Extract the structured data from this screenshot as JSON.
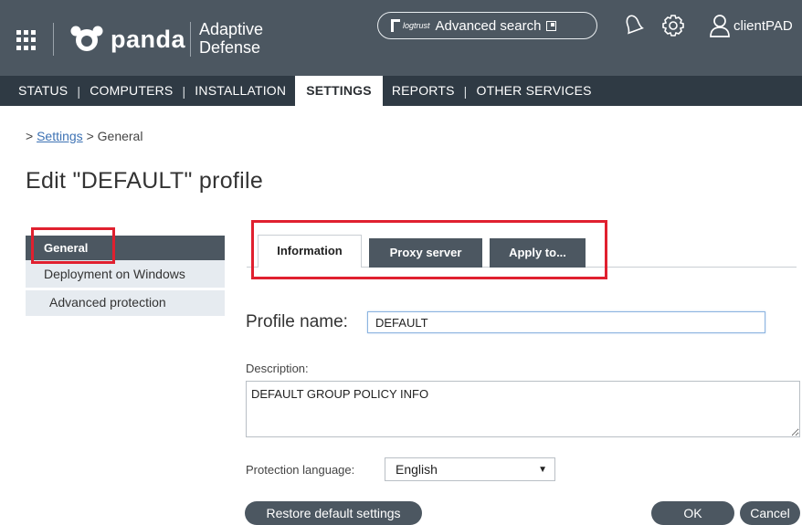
{
  "header": {
    "brand": "panda",
    "product_line1": "Adaptive",
    "product_line2": "Defense",
    "search_brand": "logtrust",
    "search_label": "Advanced search",
    "user_name": "clientPAD"
  },
  "nav": {
    "items": [
      "STATUS",
      "COMPUTERS",
      "INSTALLATION",
      "SETTINGS",
      "REPORTS",
      "OTHER SERVICES"
    ],
    "active": "SETTINGS"
  },
  "breadcrumb": {
    "prefix": ">",
    "link": "Settings",
    "separator": ">",
    "current": "General"
  },
  "page_title": "Edit \"DEFAULT\" profile",
  "sidebar": {
    "items": [
      {
        "label": "General"
      },
      {
        "label": "Deployment on Windows"
      },
      {
        "label": "Advanced protection"
      }
    ]
  },
  "tabs": [
    "Information",
    "Proxy server",
    "Apply to..."
  ],
  "form": {
    "profile_name_label": "Profile name:",
    "profile_name_value": "DEFAULT",
    "description_label": "Description:",
    "description_value": "DEFAULT GROUP POLICY INFO",
    "language_label": "Protection language:",
    "language_value": "English"
  },
  "buttons": {
    "restore": "Restore default settings",
    "ok": "OK",
    "cancel": "Cancel"
  },
  "colors": {
    "header_bg": "#4c5761",
    "nav_bg": "#2f3a44",
    "highlight_red": "#e0202f",
    "link_blue": "#3d72b4"
  }
}
